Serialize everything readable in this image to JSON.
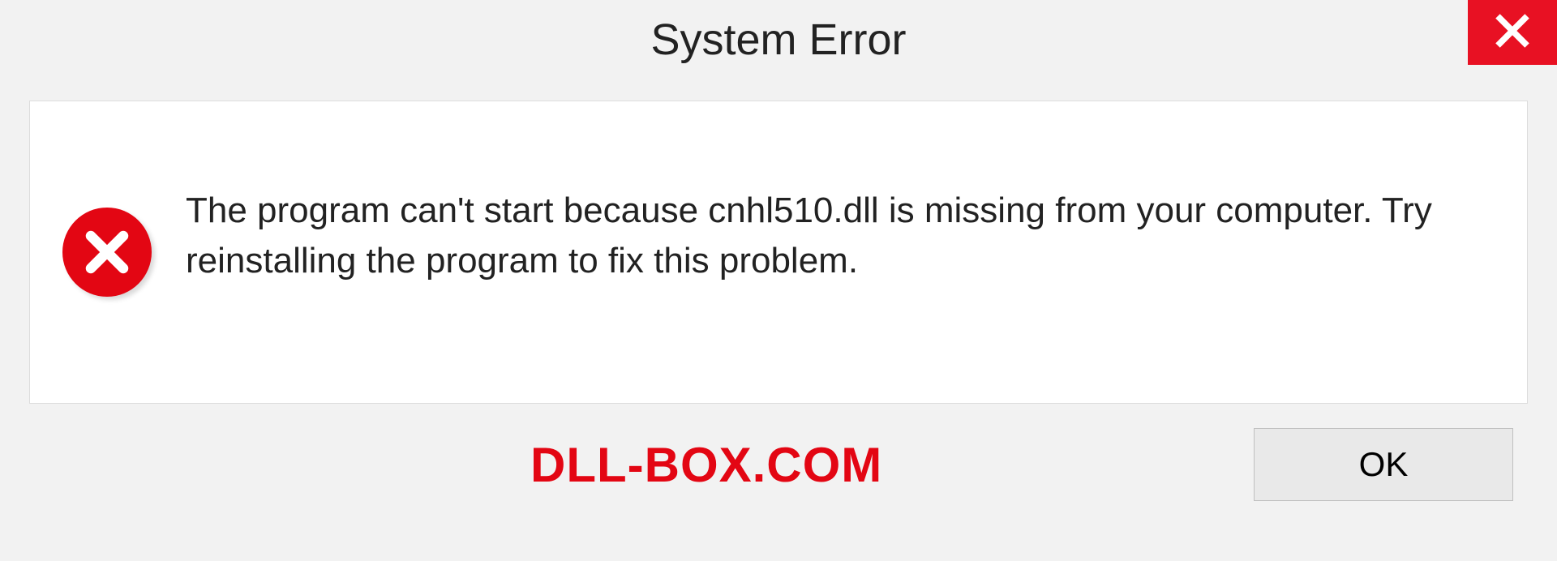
{
  "dialog": {
    "title": "System Error",
    "message": "The program can't start because cnhl510.dll is missing from your computer. Try reinstalling the program to fix this problem.",
    "ok_label": "OK"
  },
  "watermark": "DLL-BOX.COM"
}
